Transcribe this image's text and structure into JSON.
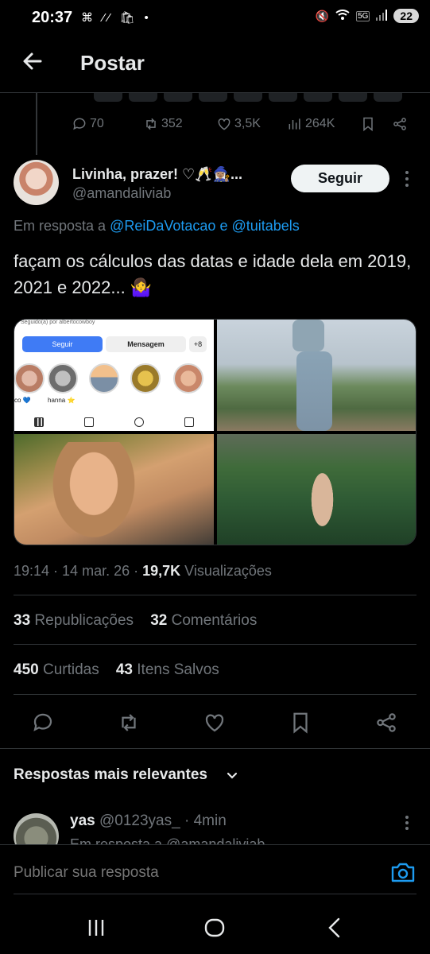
{
  "status_bar": {
    "time": "20:37",
    "left_icons": "⌘ ⁄⁄ 🛍 •",
    "network": "5G",
    "battery": "22"
  },
  "header": {
    "title": "Postar"
  },
  "parent_actions": {
    "replies": "70",
    "reposts": "352",
    "likes": "3,5K",
    "views": "264K"
  },
  "tweet": {
    "display_name": "Livinha, prazer! ♡🥂🧙🏽‍♀️...",
    "handle": "@amandaliviab",
    "follow_label": "Seguir",
    "reply_prefix": "Em resposta a",
    "reply_user1": "@ReiDaVotacao",
    "reply_and": "e",
    "reply_user2": "@tuitabels",
    "text": "façam os cálculos das datas e idade dela em 2019, 2021 e 2022... 🤷‍♀️",
    "media": {
      "ig_top": "Seguido(a) por albertocowboy",
      "ig_follow": "Seguir",
      "ig_message": "Mensagem",
      "ig_plus": "+8",
      "ig_label1": "co 💙",
      "ig_label2": "hanna ⭐"
    },
    "time": "19:14",
    "date": "14 mar. 26",
    "views_count": "19,7K",
    "views_label": "Visualizações",
    "reposts_count": "33",
    "reposts_label": "Republicações",
    "comments_count": "32",
    "comments_label": "Comentários",
    "likes_count": "450",
    "likes_label": "Curtidas",
    "saves_count": "43",
    "saves_label": "Itens Salvos"
  },
  "replies_section": {
    "sort_label": "Respostas mais relevantes"
  },
  "reply": {
    "name": "yas",
    "handle": "@0123yas_",
    "time": "· 4min",
    "sub": "Em resposta a @amandaliviab"
  },
  "compose": {
    "placeholder": "Publicar sua resposta"
  },
  "icons": {
    "back": "arrow-left",
    "camera": "camera",
    "share": "share",
    "bookmark": "bookmark"
  }
}
